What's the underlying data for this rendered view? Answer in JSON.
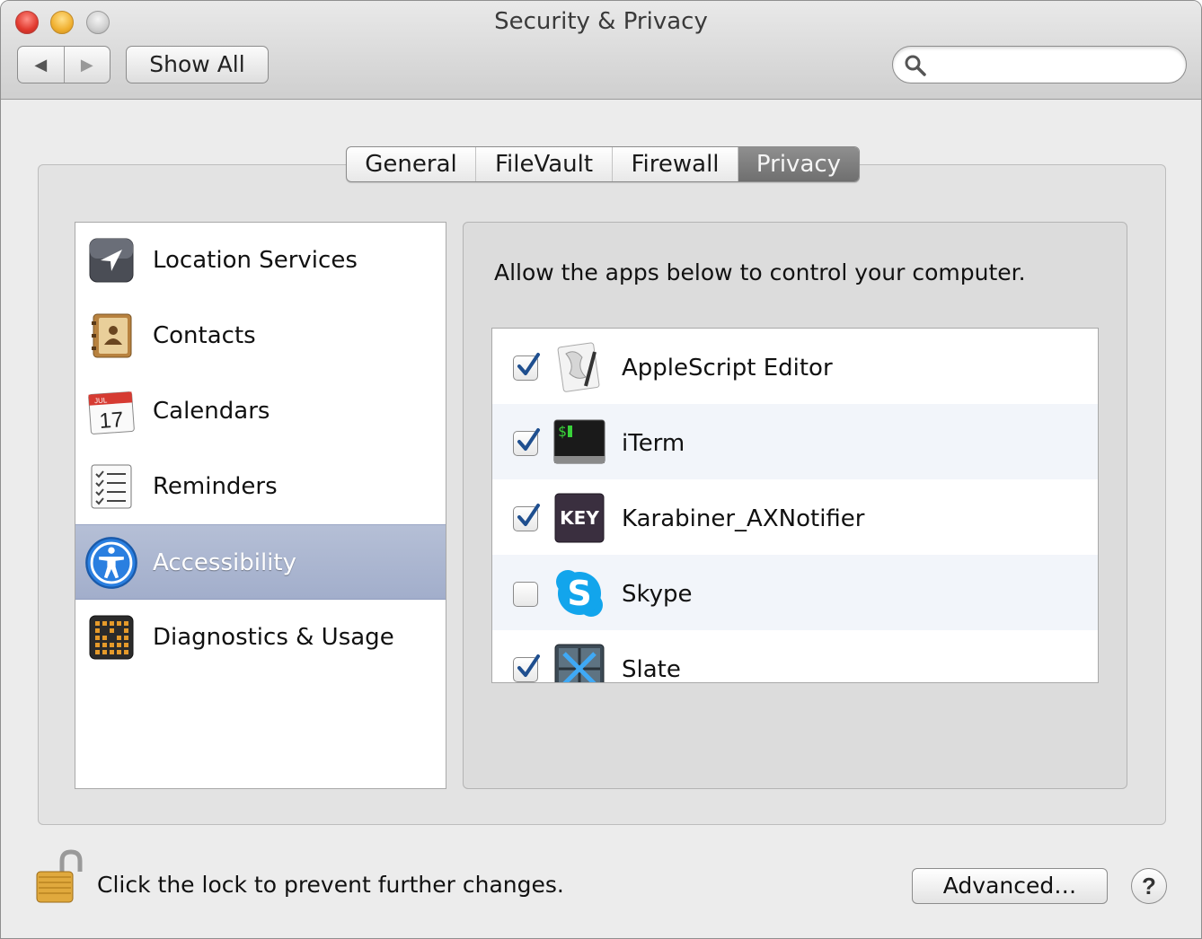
{
  "window": {
    "title": "Security & Privacy"
  },
  "toolbar": {
    "back_glyph": "◀",
    "forward_glyph": "▶",
    "show_all_label": "Show All",
    "search_placeholder": ""
  },
  "tabs": [
    {
      "label": "General",
      "active": false
    },
    {
      "label": "FileVault",
      "active": false
    },
    {
      "label": "Firewall",
      "active": false
    },
    {
      "label": "Privacy",
      "active": true
    }
  ],
  "sidebar": {
    "items": [
      {
        "label": "Location Services",
        "icon": "location-arrow-icon"
      },
      {
        "label": "Contacts",
        "icon": "contacts-book-icon"
      },
      {
        "label": "Calendars",
        "icon": "calendar-icon",
        "calendar_month": "JUL",
        "calendar_day": "17"
      },
      {
        "label": "Reminders",
        "icon": "reminders-list-icon"
      },
      {
        "label": "Accessibility",
        "icon": "accessibility-icon",
        "selected": true
      },
      {
        "label": "Diagnostics & Usage",
        "icon": "diagnostics-grid-icon"
      }
    ]
  },
  "main": {
    "instruction": "Allow the apps below to control your computer.",
    "apps": [
      {
        "name": "AppleScript Editor",
        "checked": true,
        "icon": "applescript-editor-icon"
      },
      {
        "name": "iTerm",
        "checked": true,
        "icon": "iterm-icon",
        "icon_text": "$"
      },
      {
        "name": "Karabiner_AXNotifier",
        "checked": true,
        "icon": "karabiner-key-icon",
        "icon_text": "KEY"
      },
      {
        "name": "Skype",
        "checked": false,
        "icon": "skype-icon",
        "icon_text": "S"
      },
      {
        "name": "Slate",
        "checked": true,
        "icon": "slate-icon"
      }
    ]
  },
  "footer": {
    "lock_message": "Click the lock to prevent further changes.",
    "advanced_label": "Advanced…",
    "help_label": "?"
  },
  "colors": {
    "selection": "#a9b4cf",
    "checkmark": "#1f4f8f",
    "tab_active": "#7d7d7d"
  }
}
